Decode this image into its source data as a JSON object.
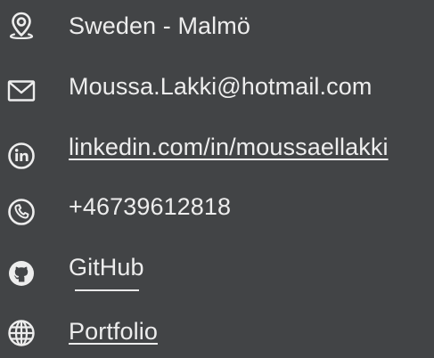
{
  "contact": {
    "location": "Sweden - Malmö",
    "email": "Moussa.Lakki@hotmail.com",
    "linkedin": "linkedin.com/in/moussaellakki",
    "phone": "+46739612818",
    "github": "GitHub",
    "portfolio": "Portfolio"
  },
  "icons": {
    "location": "location-pin-icon",
    "email": "envelope-icon",
    "linkedin": "linkedin-icon",
    "phone": "phone-icon",
    "github": "github-icon",
    "portfolio": "globe-icon"
  },
  "colors": {
    "background": "#424446",
    "text": "#ededed"
  }
}
